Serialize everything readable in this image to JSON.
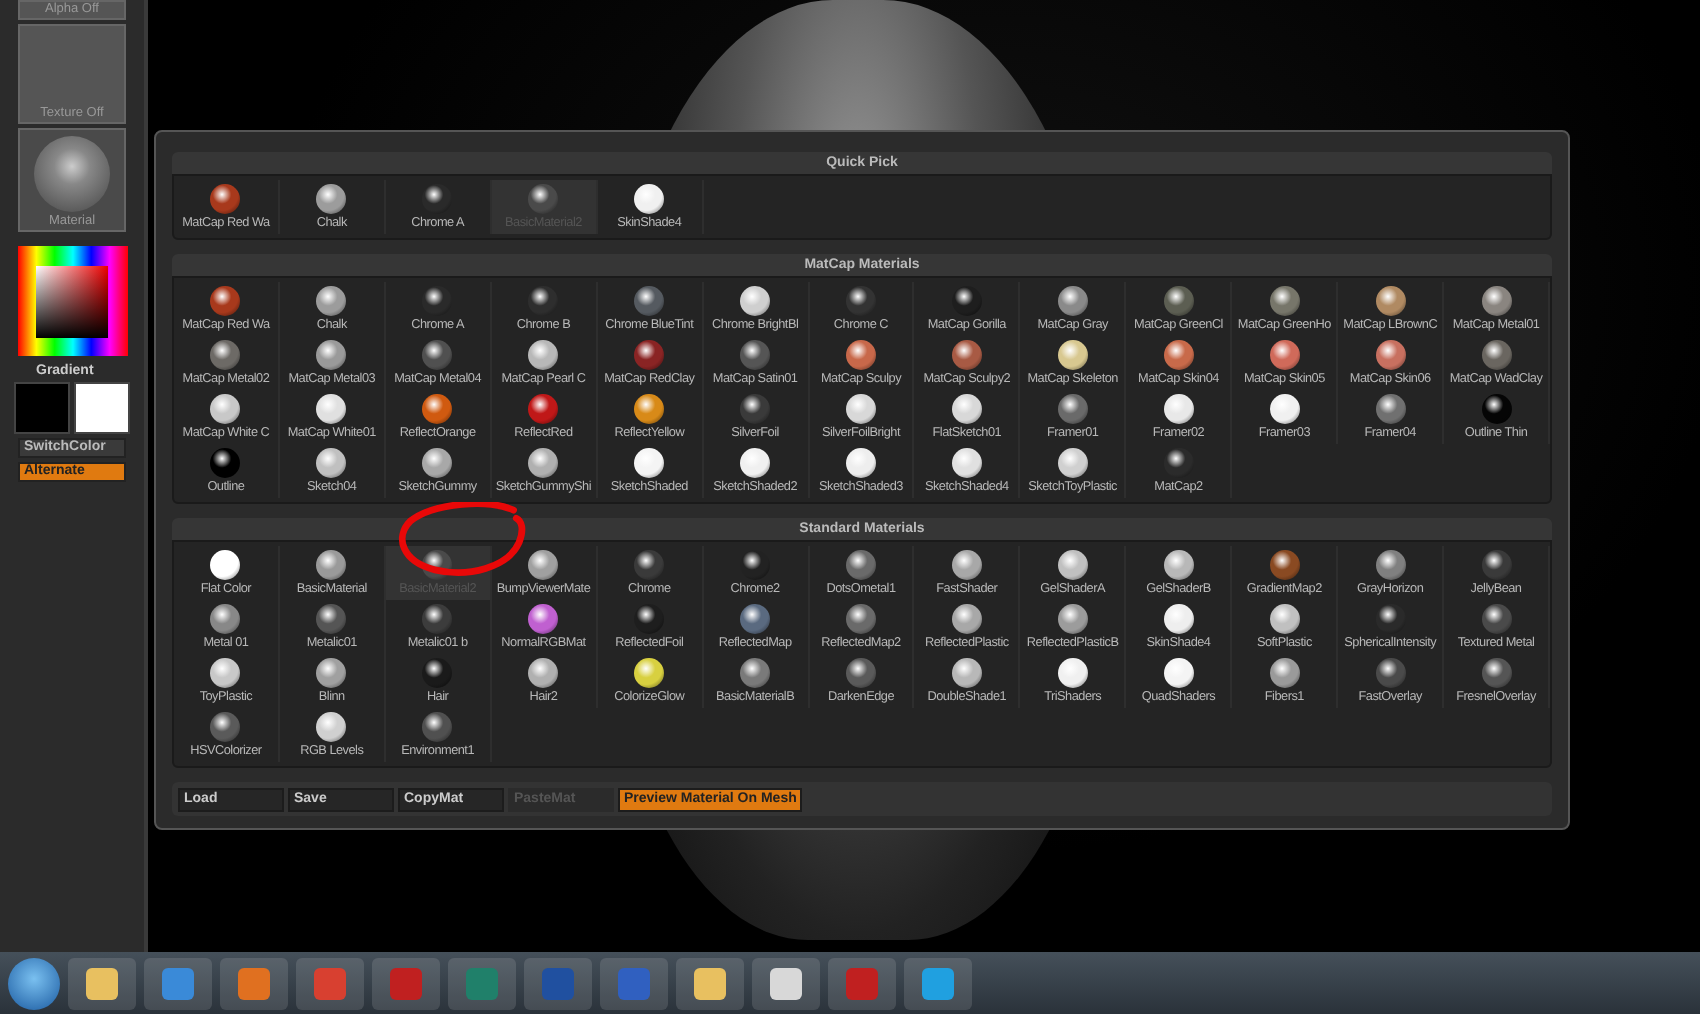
{
  "left_panel": {
    "alpha_label": "Alpha Off",
    "texture_label": "Texture Off",
    "material_label": "Material",
    "gradient_label": "Gradient",
    "switch_color": "SwitchColor",
    "alternate": {
      "label": "Alternate",
      "on": true
    }
  },
  "quick_pick": {
    "title": "Quick Pick",
    "items": [
      {
        "label": "MatCap Red Wa",
        "color": "#a8391c",
        "disabled": false
      },
      {
        "label": "Chalk",
        "color": "#9c9c9c",
        "disabled": false
      },
      {
        "label": "Chrome A",
        "color": "#2a2a2a",
        "disabled": false
      },
      {
        "label": "BasicMaterial2",
        "color": "#4a4a4a",
        "disabled": true
      },
      {
        "label": "SkinShade4",
        "color": "#f0f0f0",
        "disabled": false
      }
    ]
  },
  "matcap": {
    "title": "MatCap Materials",
    "items": [
      {
        "label": "MatCap Red Wa",
        "color": "#a8391c",
        "disabled": false
      },
      {
        "label": "Chalk",
        "color": "#9c9c9c",
        "disabled": false
      },
      {
        "label": "Chrome A",
        "color": "#2a2a2a",
        "disabled": false
      },
      {
        "label": "Chrome B",
        "color": "#2e2e2e",
        "disabled": false
      },
      {
        "label": "Chrome BlueTint",
        "color": "#555a60",
        "disabled": false
      },
      {
        "label": "Chrome BrightBl",
        "color": "#cfcfcf",
        "disabled": false
      },
      {
        "label": "Chrome C",
        "color": "#333333",
        "disabled": false
      },
      {
        "label": "MatCap Gorilla",
        "color": "#1e1e1e",
        "disabled": false
      },
      {
        "label": "MatCap Gray",
        "color": "#8a8a8a",
        "disabled": false
      },
      {
        "label": "MatCap GreenCl",
        "color": "#5c5e52",
        "disabled": false
      },
      {
        "label": "MatCap GreenHo",
        "color": "#77766a",
        "disabled": false
      },
      {
        "label": "MatCap LBrownC",
        "color": "#b08a62",
        "disabled": false
      },
      {
        "label": "MatCap Metal01",
        "color": "#8a8580",
        "disabled": false
      },
      {
        "label": "MatCap Metal02",
        "color": "#6d6a66",
        "disabled": false
      },
      {
        "label": "MatCap Metal03",
        "color": "#9a9a9a",
        "disabled": false
      },
      {
        "label": "MatCap Metal04",
        "color": "#505050",
        "disabled": false
      },
      {
        "label": "MatCap Pearl C",
        "color": "#b8b8b8",
        "disabled": false
      },
      {
        "label": "MatCap RedClay",
        "color": "#8a2424",
        "disabled": false
      },
      {
        "label": "MatCap Satin01",
        "color": "#555555",
        "disabled": false
      },
      {
        "label": "MatCap Sculpy",
        "color": "#c8684a",
        "disabled": false
      },
      {
        "label": "MatCap Sculpy2",
        "color": "#a85a44",
        "disabled": false
      },
      {
        "label": "MatCap Skeleton",
        "color": "#d8c890",
        "disabled": false
      },
      {
        "label": "MatCap Skin04",
        "color": "#c86a4a",
        "disabled": false
      },
      {
        "label": "MatCap Skin05",
        "color": "#d06a5a",
        "disabled": false
      },
      {
        "label": "MatCap Skin06",
        "color": "#c87060",
        "disabled": false
      },
      {
        "label": "MatCap WadClay",
        "color": "#6a6660",
        "disabled": false
      },
      {
        "label": "MatCap White C",
        "color": "#c8c8c8",
        "disabled": false
      },
      {
        "label": "MatCap White01",
        "color": "#e0e0e0",
        "disabled": false
      },
      {
        "label": "ReflectOrange",
        "color": "#d05a10",
        "disabled": false
      },
      {
        "label": "ReflectRed",
        "color": "#c01818",
        "disabled": false
      },
      {
        "label": "ReflectYellow",
        "color": "#d88a18",
        "disabled": false
      },
      {
        "label": "SilverFoil",
        "color": "#3a3a3a",
        "disabled": false
      },
      {
        "label": "SilverFoilBright",
        "color": "#d8d8d8",
        "disabled": false
      },
      {
        "label": "FlatSketch01",
        "color": "#d8d8d8",
        "disabled": false
      },
      {
        "label": "Framer01",
        "color": "#6a6a6a",
        "disabled": false
      },
      {
        "label": "Framer02",
        "color": "#e8e8e8",
        "disabled": false
      },
      {
        "label": "Framer03",
        "color": "#f0f0f0",
        "disabled": false
      },
      {
        "label": "Framer04",
        "color": "#707070",
        "disabled": false
      },
      {
        "label": "Outline Thin",
        "color": "#050505",
        "disabled": false
      },
      {
        "label": "Outline",
        "color": "#000000",
        "disabled": false
      },
      {
        "label": "Sketch04",
        "color": "#c0c0c0",
        "disabled": false
      },
      {
        "label": "SketchGummy",
        "color": "#a8a8a8",
        "disabled": false
      },
      {
        "label": "SketchGummyShi",
        "color": "#b0b0b0",
        "disabled": false
      },
      {
        "label": "SketchShaded",
        "color": "#f4f4f4",
        "disabled": false
      },
      {
        "label": "SketchShaded2",
        "color": "#f0f0f0",
        "disabled": false
      },
      {
        "label": "SketchShaded3",
        "color": "#eeeeee",
        "disabled": false
      },
      {
        "label": "SketchShaded4",
        "color": "#e0e0e0",
        "disabled": false
      },
      {
        "label": "SketchToyPlastic",
        "color": "#d0d0d0",
        "disabled": false
      },
      {
        "label": "MatCap2",
        "color": "#2b2b2b",
        "disabled": false
      }
    ]
  },
  "standard": {
    "title": "Standard Materials",
    "items": [
      {
        "label": "Flat Color",
        "color": "#ffffff",
        "disabled": false
      },
      {
        "label": "BasicMaterial",
        "color": "#9a9a9a",
        "disabled": false
      },
      {
        "label": "BasicMaterial2",
        "color": "#4a4a4a",
        "disabled": true
      },
      {
        "label": "BumpViewerMate",
        "color": "#a0a0a0",
        "disabled": false
      },
      {
        "label": "Chrome",
        "color": "#3a3a3a",
        "disabled": false
      },
      {
        "label": "Chrome2",
        "color": "#222222",
        "disabled": false
      },
      {
        "label": "DotsOmetal1",
        "color": "#6a6a6a",
        "disabled": false
      },
      {
        "label": "FastShader",
        "color": "#a8a8a8",
        "disabled": false
      },
      {
        "label": "GelShaderA",
        "color": "#c0c0c0",
        "disabled": false
      },
      {
        "label": "GelShaderB",
        "color": "#b8b8b8",
        "disabled": false
      },
      {
        "label": "GradientMap2",
        "color": "#8a4a22",
        "disabled": false
      },
      {
        "label": "GrayHorizon",
        "color": "#808080",
        "disabled": false
      },
      {
        "label": "JellyBean",
        "color": "#3a3a3a",
        "disabled": false
      },
      {
        "label": "Metal 01",
        "color": "#888888",
        "disabled": false
      },
      {
        "label": "Metalic01",
        "color": "#555555",
        "disabled": false
      },
      {
        "label": "Metalic01 b",
        "color": "#3c3c3c",
        "disabled": false
      },
      {
        "label": "NormalRGBMat",
        "color": "#c060d0",
        "disabled": false
      },
      {
        "label": "ReflectedFoil",
        "color": "#1e1e1e",
        "disabled": false
      },
      {
        "label": "ReflectedMap",
        "color": "#5a6a80",
        "disabled": false
      },
      {
        "label": "ReflectedMap2",
        "color": "#6a6a6a",
        "disabled": false
      },
      {
        "label": "ReflectedPlastic",
        "color": "#a8a8a8",
        "disabled": false
      },
      {
        "label": "ReflectedPlasticB",
        "color": "#9c9c9c",
        "disabled": false
      },
      {
        "label": "SkinShade4",
        "color": "#eeeeee",
        "disabled": false
      },
      {
        "label": "SoftPlastic",
        "color": "#c0c0c0",
        "disabled": false
      },
      {
        "label": "SphericalIntensity",
        "color": "#2a2a2a",
        "disabled": false
      },
      {
        "label": "Textured Metal",
        "color": "#4a4a4a",
        "disabled": false
      },
      {
        "label": "ToyPlastic",
        "color": "#c8c8c8",
        "disabled": false
      },
      {
        "label": "Blinn",
        "color": "#a0a0a0",
        "disabled": false
      },
      {
        "label": "Hair",
        "color": "#1a1a1a",
        "disabled": false
      },
      {
        "label": "Hair2",
        "color": "#b0b0b0",
        "disabled": false
      },
      {
        "label": "ColorizeGlow",
        "color": "#d8d040",
        "disabled": false
      },
      {
        "label": "BasicMaterialB",
        "color": "#7a7a7a",
        "disabled": false
      },
      {
        "label": "DarkenEdge",
        "color": "#5a5a5a",
        "disabled": false
      },
      {
        "label": "DoubleShade1",
        "color": "#b8b8b8",
        "disabled": false
      },
      {
        "label": "TriShaders",
        "color": "#f0f0f0",
        "disabled": false
      },
      {
        "label": "QuadShaders",
        "color": "#f4f4f4",
        "disabled": false
      },
      {
        "label": "Fibers1",
        "color": "#9a9a9a",
        "disabled": false
      },
      {
        "label": "FastOverlay",
        "color": "#4a4a4a",
        "disabled": false
      },
      {
        "label": "FresnelOverlay",
        "color": "#555555",
        "disabled": false
      },
      {
        "label": "HSVColorizer",
        "color": "#5a5a5a",
        "disabled": false
      },
      {
        "label": "RGB Levels",
        "color": "#d0d0d0",
        "disabled": false
      },
      {
        "label": "Environment1",
        "color": "#505050",
        "disabled": false
      }
    ]
  },
  "buttons": [
    {
      "label": "Load",
      "disabled": false,
      "on": false
    },
    {
      "label": "Save",
      "disabled": false,
      "on": false
    },
    {
      "label": "CopyMat",
      "disabled": false,
      "on": false
    },
    {
      "label": "PasteMat",
      "disabled": true,
      "on": false
    },
    {
      "label": "Preview Material On Mesh",
      "disabled": false,
      "on": true
    }
  ]
}
